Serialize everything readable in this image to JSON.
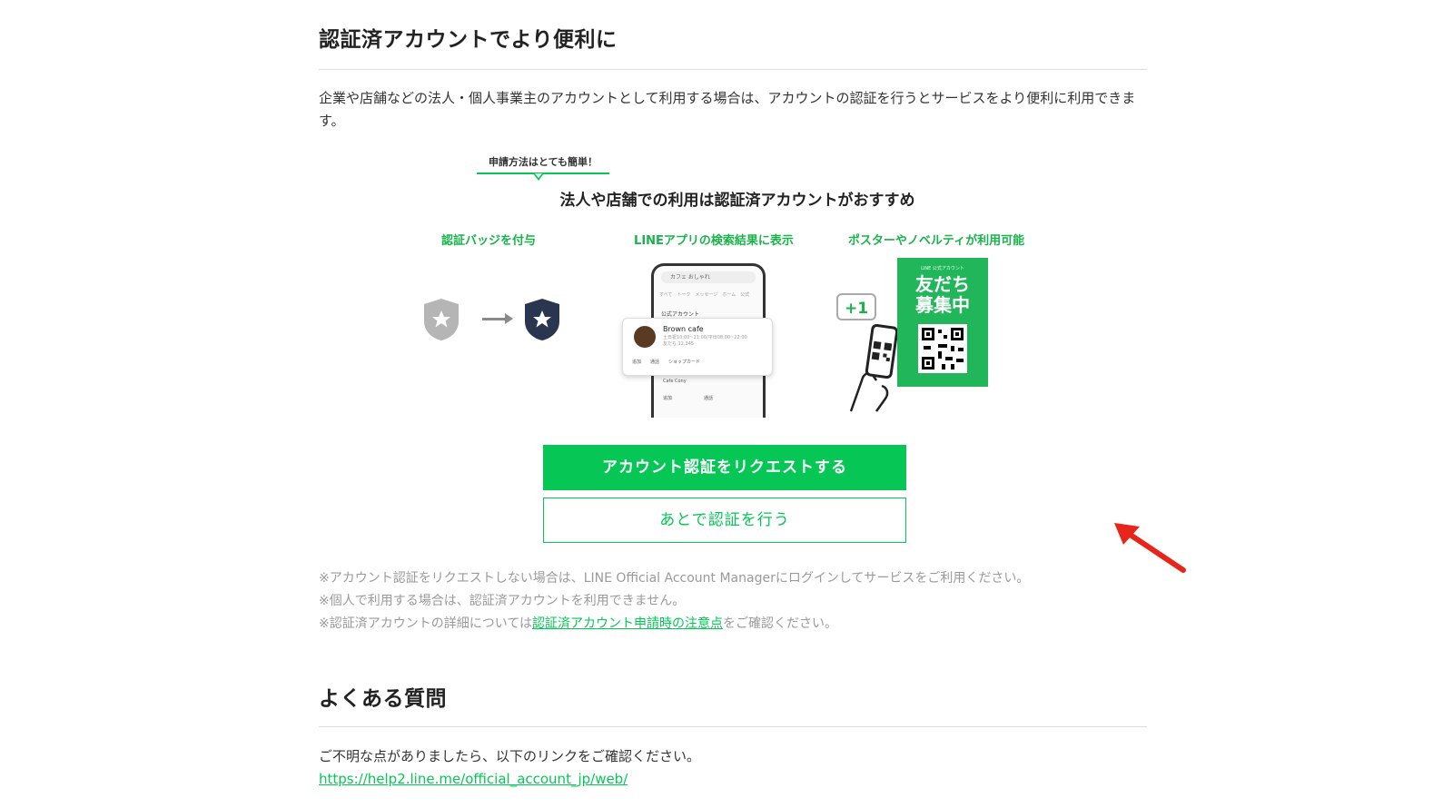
{
  "section1": {
    "title": "認証済アカウントでより便利に",
    "intro": "企業や店舗などの法人・個人事業主のアカウントとして利用する場合は、アカウントの認証を行うとサービスをより便利に利用できます。"
  },
  "illustration": {
    "tag": "申請方法はとても簡単！",
    "subtitle": "法人や店舗での利用は認証済アカウントがおすすめ",
    "features": [
      "認証バッジを付与",
      "LINEアプリの検索結果に表示",
      "ポスターやノベルティが利用可能"
    ],
    "phone": {
      "search_text": "カフェ おしゃれ",
      "tabs": "すべて　トーク　メッセージ　ホーム　公式",
      "section_label": "公式アカウント",
      "card_name": "Brown cafe",
      "card_meta_1": "土日祝10:00~21:00/平日08:00~22:00",
      "card_meta_2": "友だち 12,345",
      "card_actions": "追加　　通話　　ショップカード",
      "row2_name": "Cafe Cony",
      "row2_actions": "追加　　　　　　　通話"
    },
    "bubble": "+1",
    "poster_top": "LINE 公式アカウント",
    "poster_main_1": "友だち",
    "poster_main_2": "募集中"
  },
  "buttons": {
    "request_label": "アカウント認証をリクエストする",
    "later_label": "あとで認証を行う"
  },
  "notes": {
    "line1": "※アカウント認証をリクエストしない場合は、LINE Official Account Managerにログインしてサービスをご利用ください。",
    "line2": "※個人で利用する場合は、認証済アカウントを利用できません。",
    "line3_prefix": "※認証済アカウントの詳細については",
    "line3_link": "認証済アカウント申請時の注意点",
    "line3_suffix": "をご確認ください。"
  },
  "section2": {
    "title": "よくある質問",
    "text": "ご不明な点がありましたら、以下のリンクをご確認ください。",
    "link": "https://help2.line.me/official_account_jp/web/"
  },
  "colors": {
    "brand_green": "#06c755",
    "annotation_red": "#e8251a"
  }
}
